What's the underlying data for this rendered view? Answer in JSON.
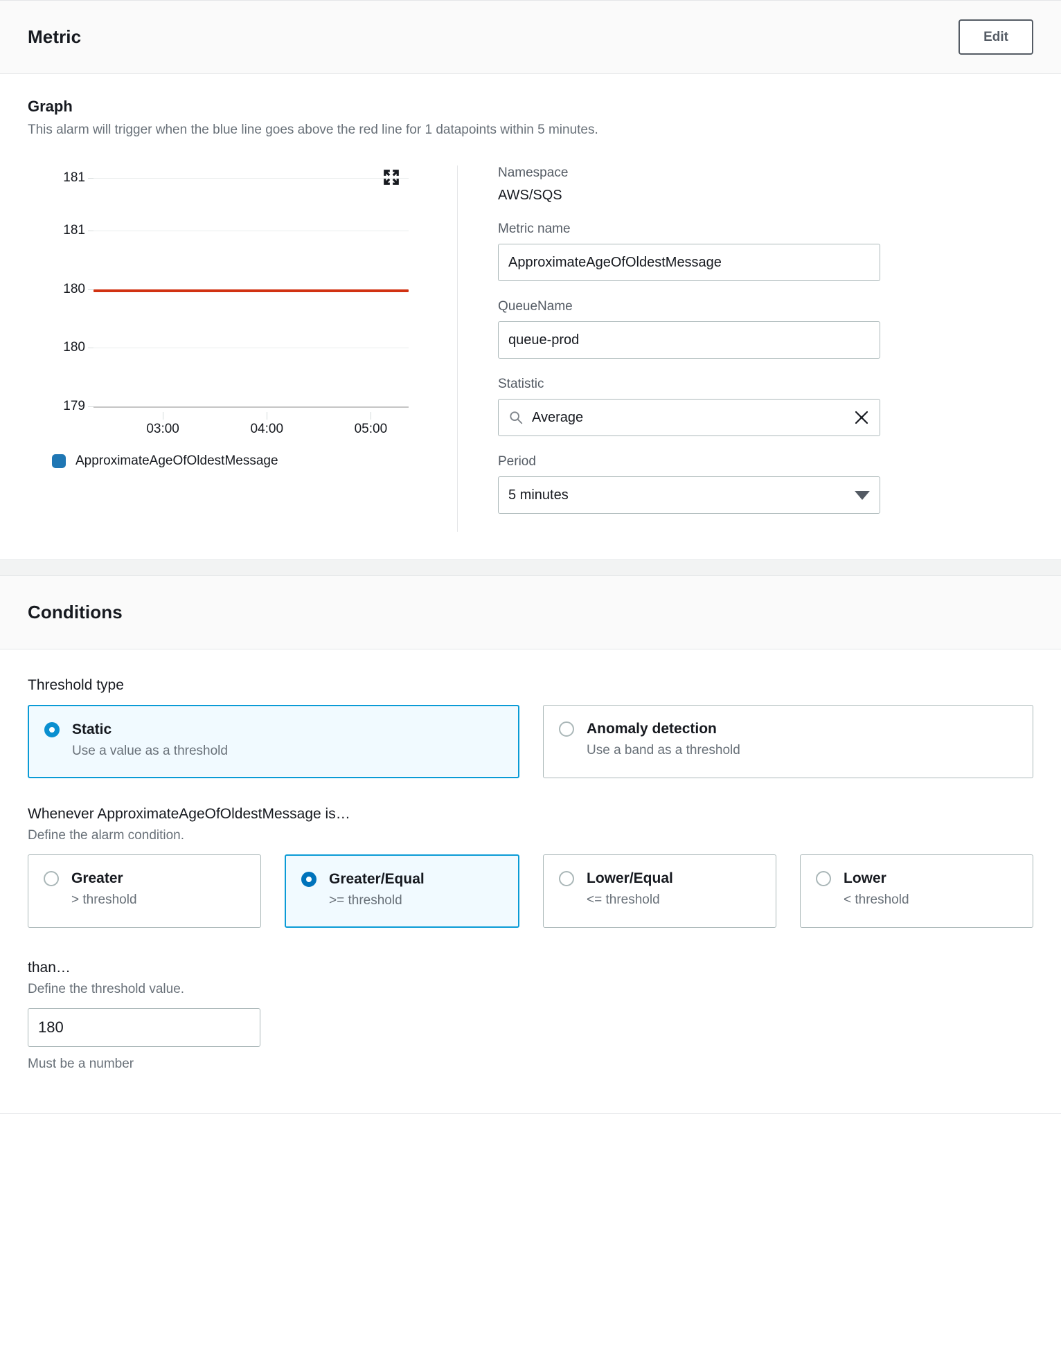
{
  "metric_panel": {
    "title": "Metric",
    "edit_label": "Edit",
    "graph_heading": "Graph",
    "graph_description": "This alarm will trigger when the blue line goes above the red line for 1 datapoints within 5 minutes.",
    "expand_icon": "expand-icon"
  },
  "chart_data": {
    "type": "line",
    "title": "Graph",
    "xlabel": "",
    "ylabel": "",
    "y_ticks": [
      "181",
      "181",
      "180",
      "180",
      "179"
    ],
    "y_tick_positions": [
      0,
      22.5,
      47.5,
      72.5,
      97.5
    ],
    "x_ticks": [
      "03:00",
      "04:00",
      "05:00"
    ],
    "x_tick_positions": [
      22,
      55,
      88
    ],
    "grid": true,
    "legend_position": "bottom-left",
    "series": [
      {
        "name": "ApproximateAgeOfOldestMessage",
        "color": "#1f77b4",
        "values": []
      }
    ],
    "threshold": {
      "name": "Threshold",
      "value": 180,
      "color": "#d13212",
      "y_position": 47.5
    }
  },
  "metric_fields": {
    "namespace_label": "Namespace",
    "namespace_value": "AWS/SQS",
    "metric_name_label": "Metric name",
    "metric_name_value": "ApproximateAgeOfOldestMessage",
    "queue_name_label": "QueueName",
    "queue_name_value": "queue-prod",
    "statistic_label": "Statistic",
    "statistic_value": "Average",
    "statistic_search_icon": "search-icon",
    "statistic_clear_icon": "close-icon",
    "period_label": "Period",
    "period_value": "5 minutes",
    "period_caret_icon": "chevron-down-icon"
  },
  "conditions_panel": {
    "title": "Conditions",
    "threshold_type_label": "Threshold type",
    "threshold_type_options": [
      {
        "label": "Static",
        "description": "Use a value as a threshold",
        "selected": true
      },
      {
        "label": "Anomaly detection",
        "description": "Use a band as a threshold",
        "selected": false
      }
    ],
    "whenever_label": "Whenever ApproximateAgeOfOldestMessage is…",
    "whenever_desc": "Define the alarm condition.",
    "comparison_options": [
      {
        "label": "Greater",
        "description": "> threshold",
        "selected": false
      },
      {
        "label": "Greater/Equal",
        "description": ">= threshold",
        "selected": true
      },
      {
        "label": "Lower/Equal",
        "description": "<= threshold",
        "selected": false
      },
      {
        "label": "Lower",
        "description": "< threshold",
        "selected": false
      }
    ],
    "than_label": "than…",
    "than_desc": "Define the threshold value.",
    "threshold_value": "180",
    "threshold_helper": "Must be a number"
  },
  "colors": {
    "accent": "#0a9bd6",
    "radio_selected": "#0073bb",
    "series_blue": "#1f77b4",
    "threshold_red": "#d13212",
    "selected_tile_bg": "#f1faff"
  }
}
